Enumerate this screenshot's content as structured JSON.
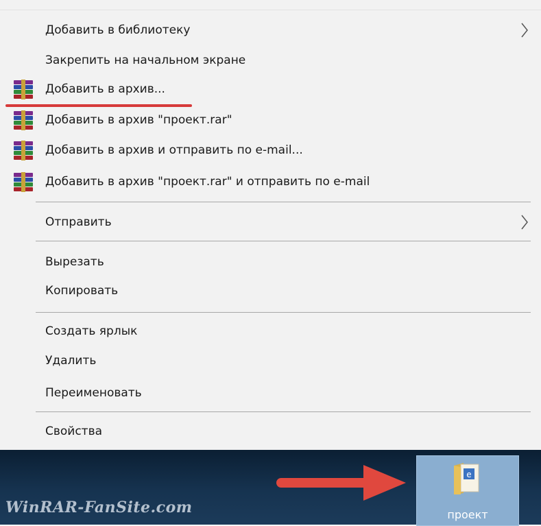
{
  "context_menu": {
    "items": [
      {
        "label": "Добавить в библиотеку",
        "submenu": true,
        "icon": null
      },
      {
        "label": "Закрепить на начальном экране",
        "submenu": false,
        "icon": null
      },
      {
        "label": "Добавить в архив...",
        "submenu": false,
        "icon": "winrar-icon"
      },
      {
        "label": "Добавить в архив \"проект.rar\"",
        "submenu": false,
        "icon": "winrar-icon"
      },
      {
        "label": "Добавить в архив и отправить по e-mail...",
        "submenu": false,
        "icon": "winrar-icon"
      },
      {
        "label": "Добавить в архив \"проект.rar\" и отправить по e-mail",
        "submenu": false,
        "icon": "winrar-icon"
      },
      {
        "label": "Отправить",
        "submenu": true,
        "icon": null
      },
      {
        "label": "Вырезать",
        "submenu": false,
        "icon": null
      },
      {
        "label": "Копировать",
        "submenu": false,
        "icon": null
      },
      {
        "label": "Создать ярлык",
        "submenu": false,
        "icon": null
      },
      {
        "label": "Удалить",
        "submenu": false,
        "icon": null
      },
      {
        "label": "Переименовать",
        "submenu": false,
        "icon": null
      },
      {
        "label": "Свойства",
        "submenu": false,
        "icon": null
      }
    ],
    "highlighted_item": "Добавить в архив...",
    "highlight_color": "#d63a3a"
  },
  "desktop": {
    "watermark": "WinRAR-FanSite.com",
    "file_name": "проект",
    "file_icon": "folder-icon",
    "arrow_icon": "red-arrow-icon",
    "arrow_color": "#e0483e"
  }
}
